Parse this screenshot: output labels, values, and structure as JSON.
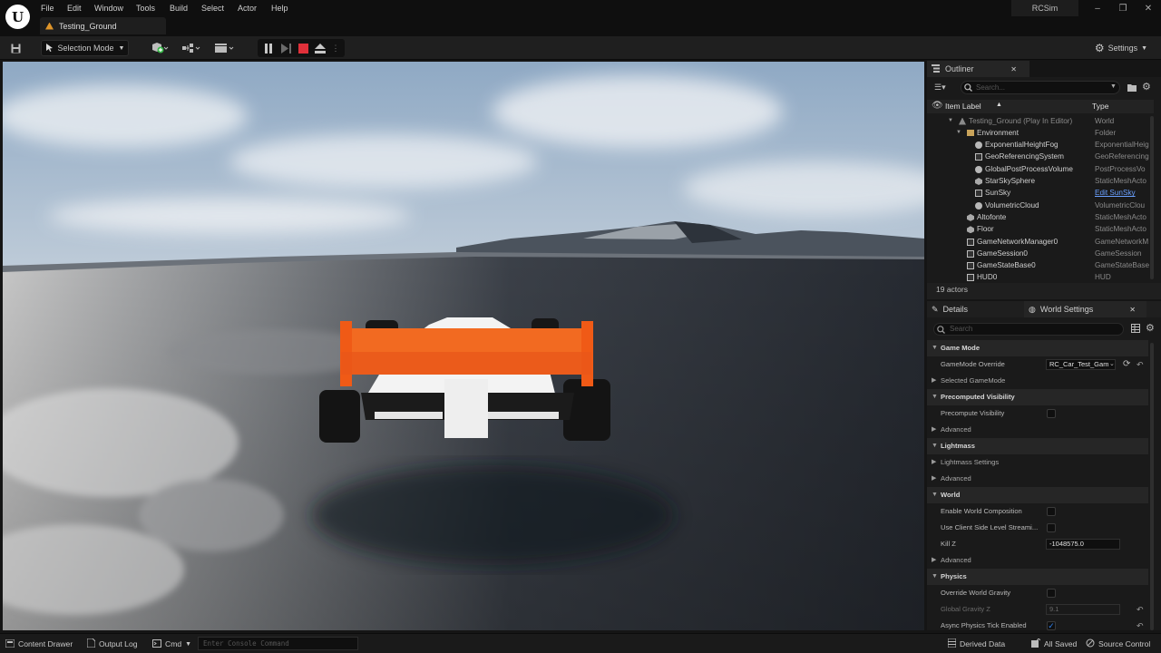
{
  "menu": [
    "File",
    "Edit",
    "Window",
    "Tools",
    "Build",
    "Select",
    "Actor",
    "Help"
  ],
  "level_tab": "Testing_Ground",
  "project_name": "RCSim",
  "window_controls": [
    "minimize-icon",
    "restore-icon",
    "close-icon"
  ],
  "toolbar": {
    "mode_label": "Selection Mode",
    "settings_label": "Settings"
  },
  "outliner": {
    "tab_label": "Outliner",
    "search_placeholder": "Search...",
    "col_label": "Item Label",
    "col_type": "Type",
    "rows": [
      {
        "label": "Testing_Ground (Play In Editor)",
        "type": "World",
        "indent": 0,
        "icon": "world-icon",
        "dim": true
      },
      {
        "label": "Environment",
        "type": "Folder",
        "indent": 1,
        "icon": "folder-icon"
      },
      {
        "label": "ExponentialHeightFog",
        "type": "ExponentialHeig",
        "indent": 2,
        "icon": "fog-icon"
      },
      {
        "label": "GeoReferencingSystem",
        "type": "GeoReferencing",
        "indent": 2,
        "icon": "actor-icon"
      },
      {
        "label": "GlobalPostProcessVolume",
        "type": "PostProcessVo",
        "indent": 2,
        "icon": "volume-icon"
      },
      {
        "label": "StarSkySphere",
        "type": "StaticMeshActo",
        "indent": 2,
        "icon": "mesh-icon"
      },
      {
        "label": "SunSky",
        "type": "Edit SunSky",
        "indent": 2,
        "icon": "actor-icon",
        "link": true
      },
      {
        "label": "VolumetricCloud",
        "type": "VolumetricClou",
        "indent": 2,
        "icon": "cloud-icon"
      },
      {
        "label": "Altofonte",
        "type": "StaticMeshActo",
        "indent": 1,
        "icon": "mesh-icon"
      },
      {
        "label": "Floor",
        "type": "StaticMeshActo",
        "indent": 1,
        "icon": "mesh-icon"
      },
      {
        "label": "GameNetworkManager0",
        "type": "GameNetworkM",
        "indent": 1,
        "icon": "actor-icon"
      },
      {
        "label": "GameSession0",
        "type": "GameSession",
        "indent": 1,
        "icon": "actor-icon"
      },
      {
        "label": "GameStateBase0",
        "type": "GameStateBase",
        "indent": 1,
        "icon": "actor-icon"
      },
      {
        "label": "HUD0",
        "type": "HUD",
        "indent": 1,
        "icon": "actor-icon"
      }
    ],
    "actor_count": "19 actors"
  },
  "details": {
    "tab_details": "Details",
    "tab_world_settings": "World Settings",
    "search_placeholder": "Search",
    "rows": [
      {
        "kind": "cat",
        "text": "Game Mode"
      },
      {
        "kind": "prop",
        "text": "GameMode Override",
        "value": "RC_Car_Test_Gam"
      },
      {
        "kind": "sub",
        "text": "Selected GameMode"
      },
      {
        "kind": "cat",
        "text": "Precomputed Visibility"
      },
      {
        "kind": "prop",
        "text": "Precompute Visibility",
        "check": false
      },
      {
        "kind": "sub",
        "text": "Advanced"
      },
      {
        "kind": "cat",
        "text": "Lightmass"
      },
      {
        "kind": "sub",
        "text": "Lightmass Settings"
      },
      {
        "kind": "sub",
        "text": "Advanced"
      },
      {
        "kind": "cat",
        "text": "World"
      },
      {
        "kind": "prop",
        "text": "Enable World Composition",
        "check": false
      },
      {
        "kind": "prop",
        "text": "Use Client Side Level Streami...",
        "check": false
      },
      {
        "kind": "prop",
        "text": "Kill Z",
        "value": "-1048575.0"
      },
      {
        "kind": "sub",
        "text": "Advanced"
      },
      {
        "kind": "cat",
        "text": "Physics"
      },
      {
        "kind": "prop",
        "text": "Override World Gravity",
        "check": false
      },
      {
        "kind": "prop",
        "text": "Global Gravity Z",
        "value": "9.1",
        "dim": true
      },
      {
        "kind": "prop",
        "text": "Async Physics Tick Enabled",
        "check": true
      }
    ]
  },
  "statusbar": {
    "content_drawer": "Content Drawer",
    "output_log": "Output Log",
    "cmd": "Cmd",
    "console_placeholder": "Enter Console Command",
    "derived_data": "Derived Data",
    "all_saved": "All Saved",
    "source_control": "Source Control"
  },
  "colors": {
    "accent_blue": "#2f80ed",
    "stop_red": "#e0303a",
    "link_blue": "#6aa0ff",
    "car_orange": "#f26a21"
  }
}
